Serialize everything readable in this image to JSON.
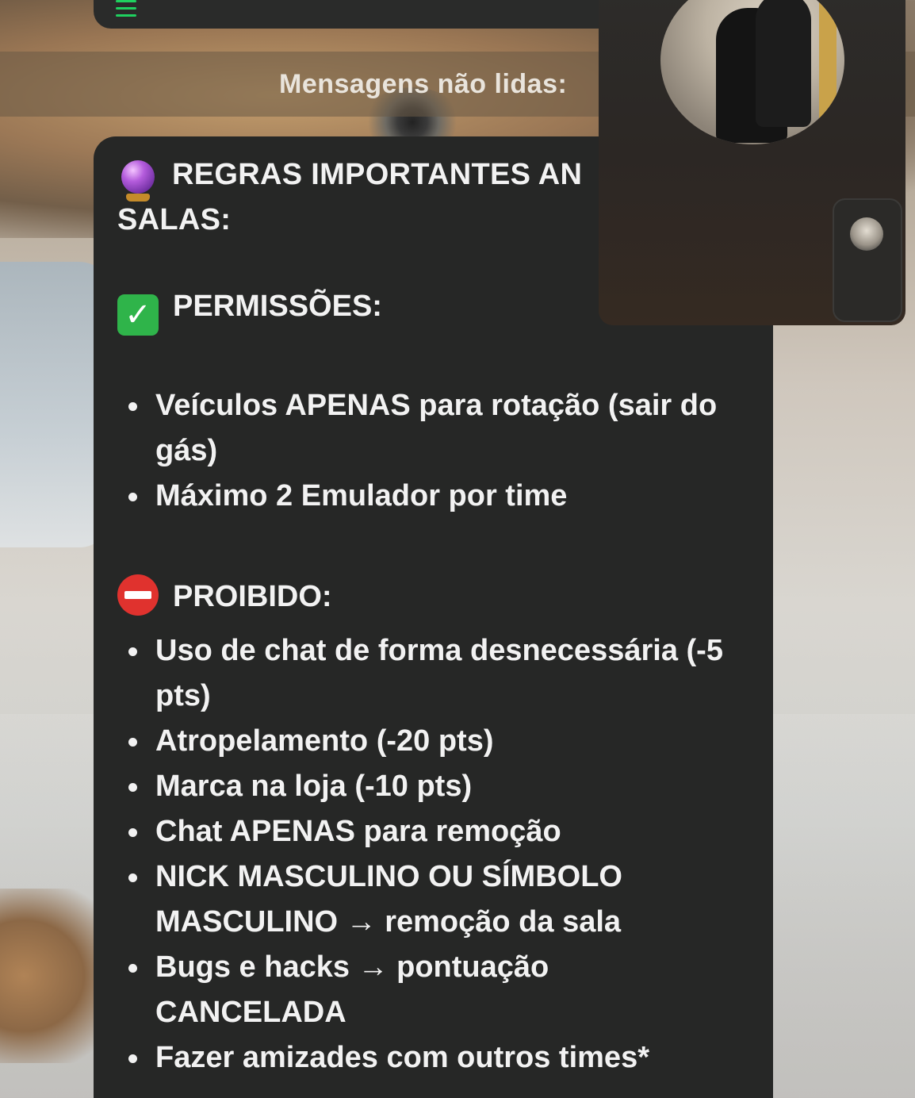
{
  "header": {
    "menu_icon": "hamburger-menu-icon",
    "accent_color": "#1fd15f"
  },
  "banner": {
    "unread_label": "Mensagens não lidas:"
  },
  "message": {
    "title_emoji": "crystal-ball-emoji",
    "title": "REGRAS IMPORTANTES AN SALAS:",
    "permissions": {
      "emoji": "check-mark-emoji",
      "heading": "PERMISSÕES:",
      "items": [
        "Veículos APENAS para rotação (sair do gás)",
        "Máximo 2 Emulador por time"
      ]
    },
    "prohibited": {
      "emoji": "no-entry-emoji",
      "heading": "PROIBIDO:",
      "items": [
        "Uso de chat de forma desnecessária (-5 pts)",
        "Atropelamento (-20 pts)",
        "Marca na loja (-10 pts)",
        "Chat APENAS para remoção",
        "NICK MASCULINO OU SÍMBOLO MASCULINO → remoção da sala",
        "Bugs e hacks → pontuação CANCELADA",
        "Fazer amizades com outros times*"
      ]
    }
  },
  "video_call": {
    "main_avatar": "contact-photo",
    "self_preview": "self-camera-thumbnail"
  }
}
